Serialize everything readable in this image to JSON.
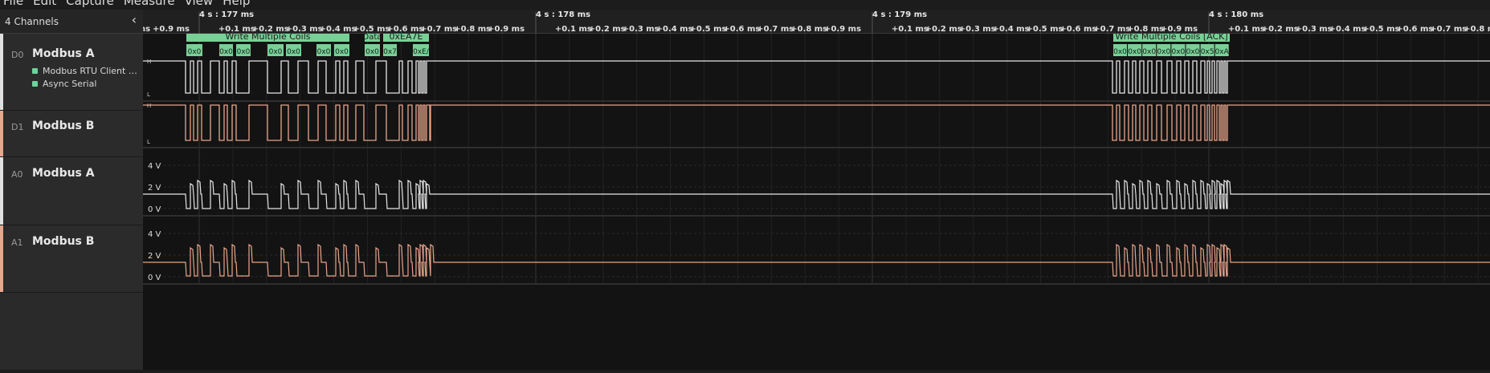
{
  "menu": [
    "File",
    "Edit",
    "Capture",
    "Measure",
    "View",
    "Help"
  ],
  "sidebar": {
    "channel_count": "4 Channels",
    "collapse_icon": "chevron-left-icon",
    "channels": [
      {
        "id": "D0",
        "name": "Modbus A",
        "color": "#e0e0e0",
        "analyzers": [
          "Modbus RTU Client & Ser...",
          "Async Serial"
        ]
      },
      {
        "id": "D1",
        "name": "Modbus B",
        "color": "#e6a78e",
        "analyzers": []
      },
      {
        "id": "A0",
        "name": "Modbus A",
        "color": "#e0e0e0",
        "analyzers": []
      },
      {
        "id": "A1",
        "name": "Modbus B",
        "color": "#e6a78e",
        "analyzers": []
      }
    ]
  },
  "timeline": {
    "major": [
      "4 s : 177 ms",
      "4 s : 178 ms",
      "4 s : 179 ms",
      "4 s : 180 ms"
    ],
    "minor": [
      "+0.1 ms",
      "+0.2 ms",
      "+0.3 ms",
      "+0.4 ms",
      "+0.5 ms",
      "+0.6 ms",
      "+0.7 ms",
      "+0.8 ms",
      "+0.9 ms"
    ],
    "leading_minor": [
      "ns",
      "+0.9 ms"
    ]
  },
  "digital": {
    "high_label": "H",
    "low_label": "L"
  },
  "analog": {
    "ticks": [
      "4 V",
      "2 V",
      "0 V"
    ]
  },
  "decode": {
    "frame1": "Write Multiple Coils",
    "frame2": "Data",
    "frame3": "0xEA7E",
    "frame4": "Write Multiple Coils [ACK]",
    "bytes1": [
      "0x0",
      "0x0",
      "0x0",
      "0x0",
      "0x0",
      "0x0",
      "0x0"
    ],
    "bytes2": [
      "0x0",
      "0x7",
      "0xE/"
    ],
    "bytes4": [
      "0x0",
      "0x0",
      "0x0",
      "0x0",
      "0x0",
      "0x0",
      "0x5",
      "0xA"
    ]
  },
  "colors": {
    "white_trace": "#e6e6e6",
    "salmon_trace": "#e8a58b",
    "decode_green": "#77d196"
  }
}
